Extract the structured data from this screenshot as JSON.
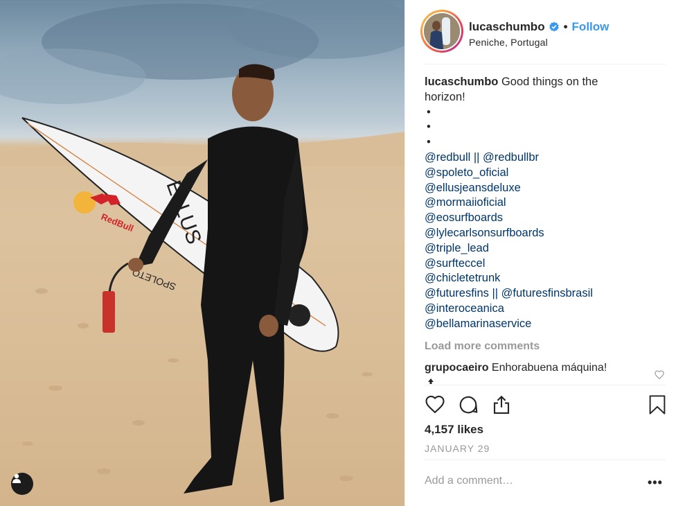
{
  "post": {
    "username": "lucaschumbo",
    "follow_label": "Follow",
    "separator": "•",
    "location": "Peniche, Portugal"
  },
  "caption": {
    "username": "lucaschumbo",
    "text_line1": "Good things on the",
    "text_line2": "horizon!",
    "bullets": [
      "•",
      "•",
      "•"
    ],
    "mention_lines": [
      [
        "@redbull",
        " || ",
        "@redbullbr"
      ],
      [
        "@spoleto_oficial"
      ],
      [
        "@ellusjeansdeluxe"
      ],
      [
        "@mormaiioficial"
      ],
      [
        "@eosurfboards"
      ],
      [
        "@lylecarlsonsurfboards"
      ],
      [
        "@triple_lead"
      ],
      [
        "@surfteccel"
      ],
      [
        "@chicletetrunk"
      ],
      [
        "@futuresfins",
        " || ",
        "@futuresfinsbrasil"
      ],
      [
        "@interoceanica"
      ],
      [
        "@bellamarinaservice"
      ]
    ]
  },
  "load_more": "Load more comments",
  "comment": {
    "username": "grupocaeiro",
    "text": "Enhorabuena máquina!"
  },
  "likes": "4,157 likes",
  "date": "JANUARY 29",
  "add_comment_placeholder": "Add a comment…",
  "more_options": "•••",
  "photo_board_text": {
    "brand1": "RedBull",
    "brand2": "ELLUS",
    "brand3": "SPOLETO"
  },
  "icons": {
    "verified": "verified-badge-icon",
    "heart": "heart-icon",
    "comment": "comment-bubble-icon",
    "share": "share-icon",
    "bookmark": "bookmark-icon",
    "user_tag": "user-tag-icon"
  },
  "colors": {
    "link": "#003569",
    "follow": "#3897f0",
    "muted": "#999999"
  }
}
